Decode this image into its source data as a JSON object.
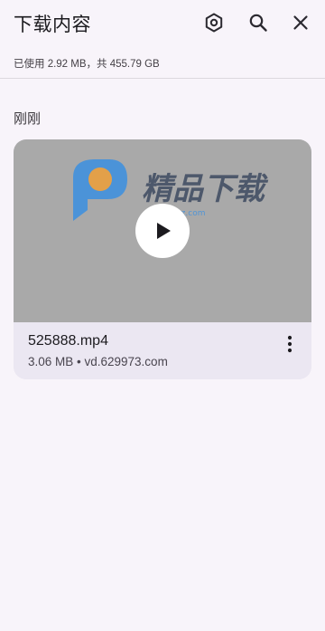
{
  "header": {
    "title": "下载内容",
    "icons": [
      "settings-icon",
      "search-icon",
      "close-icon"
    ]
  },
  "storage": {
    "text": "已使用 2.92 MB，共 455.79 GB"
  },
  "sections": [
    {
      "label": "刚刚",
      "items": [
        {
          "filename": "525888.mp4",
          "meta": "3.06 MB • vd.629973.com",
          "watermark_text": "精品下载",
          "watermark_url": "www.jpxz.com"
        }
      ]
    }
  ],
  "colors": {
    "background": "#f8f4fa",
    "card_info": "#ebe7f2",
    "thumbnail": "#a9a9a9",
    "watermark_blue": "#3b8fe0",
    "watermark_orange": "#f4a23a"
  }
}
